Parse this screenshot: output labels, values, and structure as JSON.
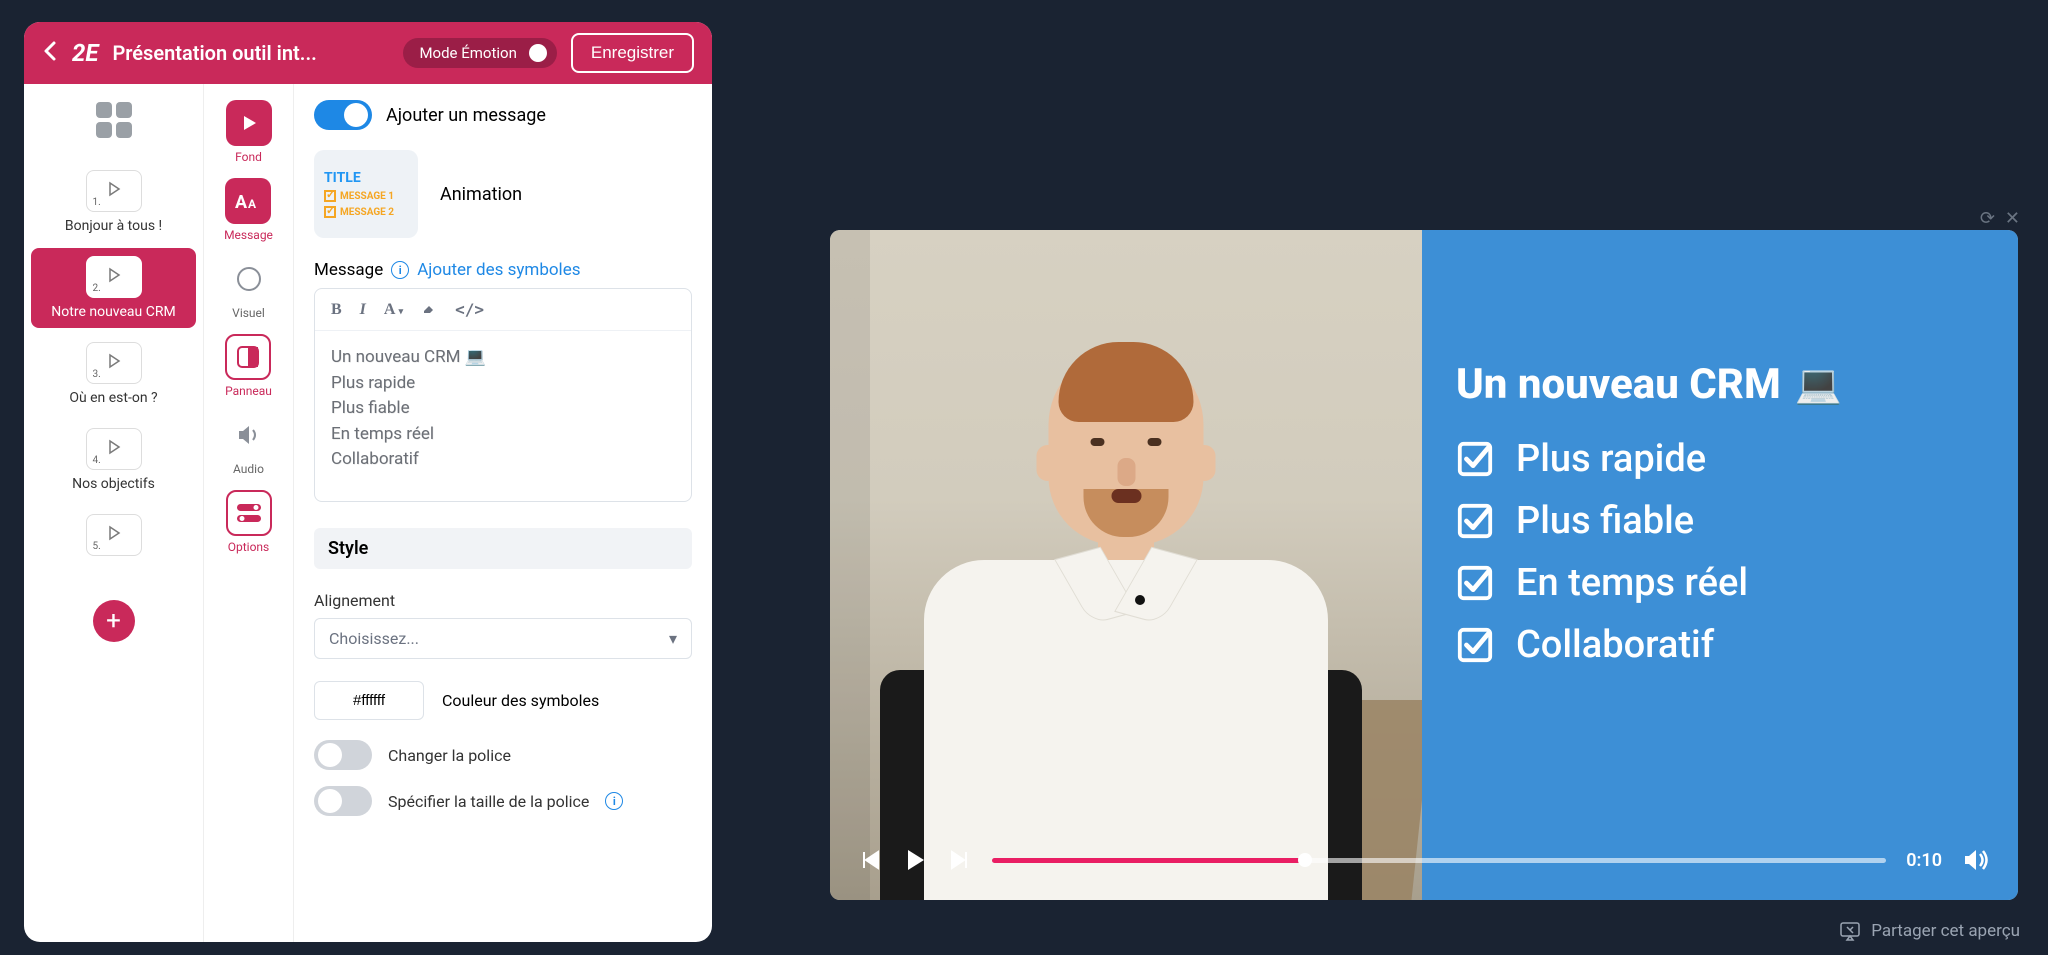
{
  "header": {
    "doc_title": "Présentation outil int...",
    "mode_label": "Mode Émotion",
    "save_label": "Enregistrer"
  },
  "slides": [
    {
      "num": "1.",
      "label": "Bonjour à tous !"
    },
    {
      "num": "2.",
      "label": "Notre nouveau CRM"
    },
    {
      "num": "3.",
      "label": "Où en est-on ?"
    },
    {
      "num": "4.",
      "label": "Nos objectifs"
    },
    {
      "num": "5.",
      "label": ""
    }
  ],
  "tabs": {
    "fond": "Fond",
    "message": "Message",
    "visuel": "Visuel",
    "panneau": "Panneau",
    "audio": "Audio",
    "options": "Options"
  },
  "content": {
    "toggle_label": "Ajouter un message",
    "anim_title": "TITLE",
    "anim_msg1": "MESSAGE 1",
    "anim_msg2": "MESSAGE 2",
    "anim_label": "Animation",
    "msg_label": "Message",
    "add_symbols": "Ajouter des symboles",
    "editor_lines": [
      "Un nouveau CRM 💻",
      "Plus rapide",
      "Plus fiable",
      "En temps réel",
      "Collaboratif"
    ],
    "style_header": "Style",
    "align_label": "Alignement",
    "align_placeholder": "Choisissez...",
    "color_value": "#ffffff",
    "color_label": "Couleur des symboles",
    "font_toggle": "Changer la police",
    "size_toggle": "Spécifier la taille de la police"
  },
  "preview": {
    "title": "Un nouveau CRM",
    "bullets": [
      "Plus rapide",
      "Plus fiable",
      "En temps réel",
      "Collaboratif"
    ],
    "time": "0:10",
    "share": "Partager cet aperçu"
  }
}
